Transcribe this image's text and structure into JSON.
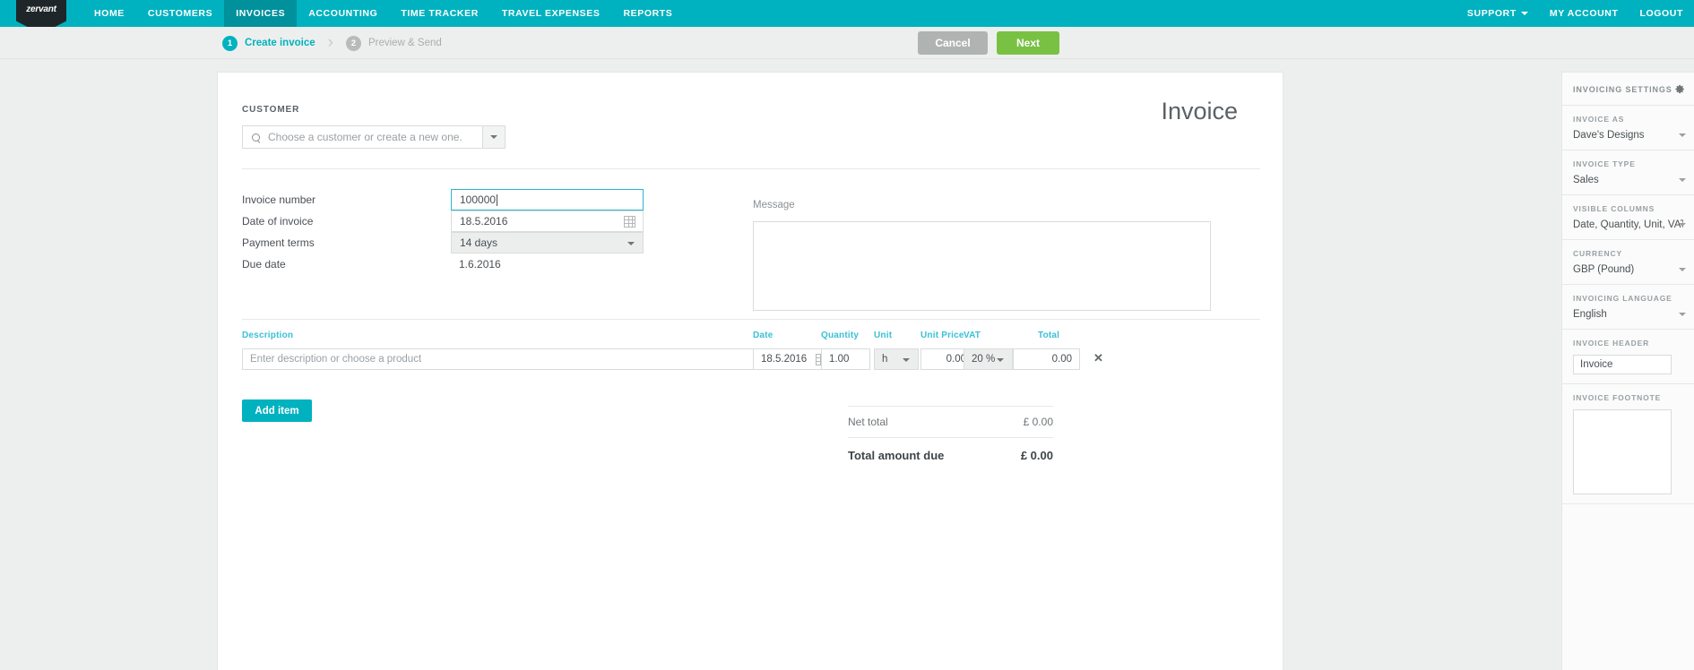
{
  "brand": {
    "logo_text": "zervant",
    "teal": "#00b2bf",
    "teal_dark": "#00919d",
    "green": "#79c143",
    "gray": "#afb4b3",
    "accent_label": "#39c0d6"
  },
  "topnav": {
    "items": [
      {
        "label": "HOME",
        "active": false
      },
      {
        "label": "CUSTOMERS",
        "active": false
      },
      {
        "label": "INVOICES",
        "active": true
      },
      {
        "label": "ACCOUNTING",
        "active": false
      },
      {
        "label": "TIME TRACKER",
        "active": false
      },
      {
        "label": "TRAVEL EXPENSES",
        "active": false
      },
      {
        "label": "REPORTS",
        "active": false
      }
    ],
    "right_items": [
      {
        "label": "SUPPORT",
        "has_caret": true
      },
      {
        "label": "MY ACCOUNT",
        "has_caret": false
      },
      {
        "label": "LOGOUT",
        "has_caret": false
      }
    ]
  },
  "steps": {
    "step1": {
      "number": "1",
      "label": "Create invoice"
    },
    "separator": "›",
    "step2": {
      "number": "2",
      "label": "Preview & Send"
    }
  },
  "actions": {
    "cancel_label": "Cancel",
    "next_label": "Next"
  },
  "invoice": {
    "title": "Invoice",
    "customer_section_label": "CUSTOMER",
    "customer_placeholder": "Choose a customer or create a new one.",
    "fields": [
      {
        "label": "Invoice number",
        "value": "100000",
        "type": "text",
        "focused": true
      },
      {
        "label": "Date of invoice",
        "value": "18.5.2016",
        "type": "date",
        "focused": false
      },
      {
        "label": "Payment terms",
        "value": "14 days",
        "type": "select",
        "focused": false
      },
      {
        "label": "Due date",
        "value": "1.6.2016",
        "type": "static",
        "focused": false
      }
    ],
    "message_label": "Message",
    "message_value": ""
  },
  "items": {
    "columns": [
      {
        "key": "description",
        "label": "Description"
      },
      {
        "key": "date",
        "label": "Date"
      },
      {
        "key": "quantity",
        "label": "Quantity"
      },
      {
        "key": "unit",
        "label": "Unit"
      },
      {
        "key": "unit_price",
        "label": "Unit Price"
      },
      {
        "key": "vat",
        "label": "VAT"
      },
      {
        "key": "total",
        "label": "Total"
      }
    ],
    "rows": [
      {
        "description_placeholder": "Enter description or choose a product",
        "description": "",
        "date": "18.5.2016",
        "quantity": "1.00",
        "unit": "h",
        "unit_price": "0.00",
        "vat": "20 %",
        "total": "0.00",
        "remove_label": "✕"
      }
    ],
    "add_item_label": "Add item"
  },
  "totals": {
    "net_label": "Net total",
    "net_value": "£ 0.00",
    "grand_label": "Total amount due",
    "grand_value": "£ 0.00"
  },
  "sidebar": {
    "title": "INVOICING SETTINGS",
    "sections": [
      {
        "label": "INVOICE AS",
        "value": "Dave's Designs",
        "kind": "select"
      },
      {
        "label": "INVOICE TYPE",
        "value": "Sales",
        "kind": "select"
      },
      {
        "label": "VISIBLE COLUMNS",
        "value": "Date, Quantity, Unit, VAT, U…",
        "kind": "select"
      },
      {
        "label": "CURRENCY",
        "value": "GBP (Pound)",
        "kind": "select"
      },
      {
        "label": "INVOICING LANGUAGE",
        "value": "English",
        "kind": "select"
      },
      {
        "label": "INVOICE HEADER",
        "value": "Invoice",
        "kind": "input"
      },
      {
        "label": "INVOICE FOOTNOTE",
        "value": "",
        "kind": "textarea"
      }
    ]
  }
}
